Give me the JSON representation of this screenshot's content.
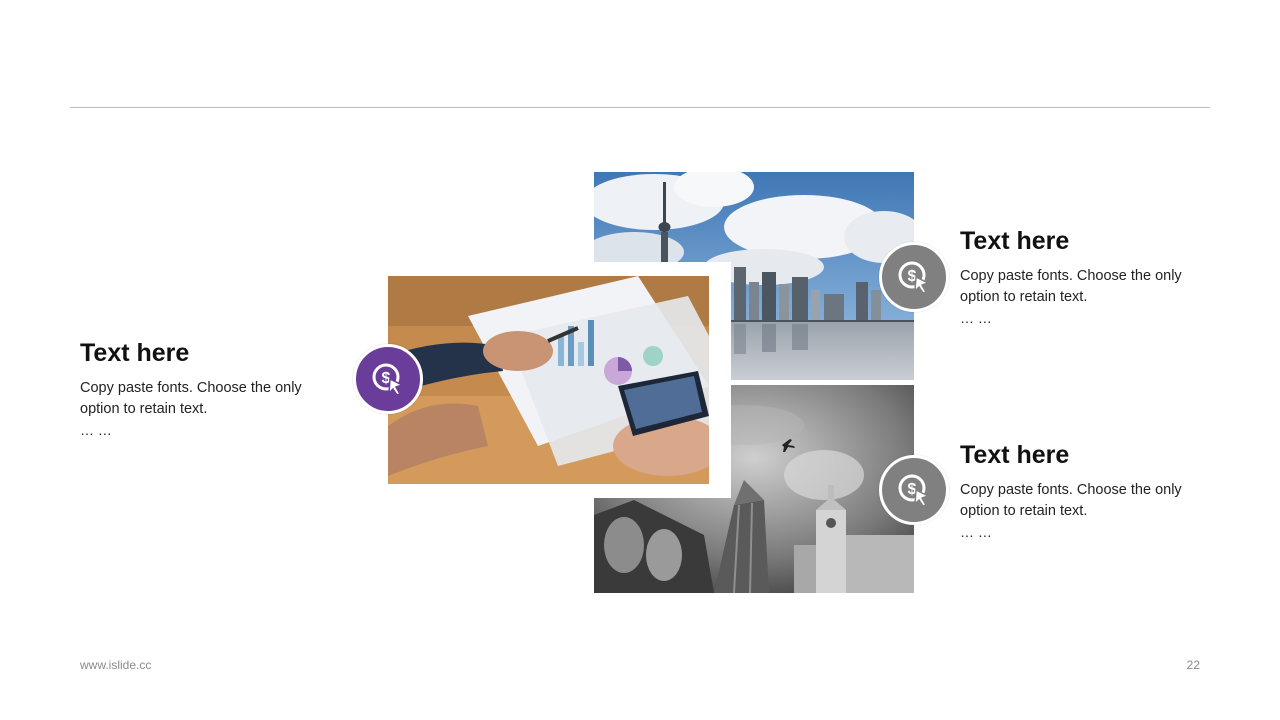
{
  "left_block": {
    "title": "Text here",
    "body": "Copy paste fonts. Choose the only option to retain text.",
    "ellipsis": "… …"
  },
  "right_top_block": {
    "title": "Text here",
    "body": "Copy paste fonts. Choose the only option to retain text.",
    "ellipsis": "… …"
  },
  "right_bottom_block": {
    "title": "Text here",
    "body": "Copy paste fonts. Choose the only option to retain text.",
    "ellipsis": "… …"
  },
  "badges": [
    {
      "icon": "dollar-cursor-icon",
      "color": "#6a3d9a"
    },
    {
      "icon": "dollar-cursor-icon",
      "color": "#808080"
    },
    {
      "icon": "dollar-cursor-icon",
      "color": "#808080"
    }
  ],
  "photos": [
    {
      "name": "city-skyline-photo"
    },
    {
      "name": "business-charts-photo"
    },
    {
      "name": "bw-skyscrapers-photo"
    }
  ],
  "footer": {
    "website": "www.islide.cc",
    "page_number": "22"
  }
}
